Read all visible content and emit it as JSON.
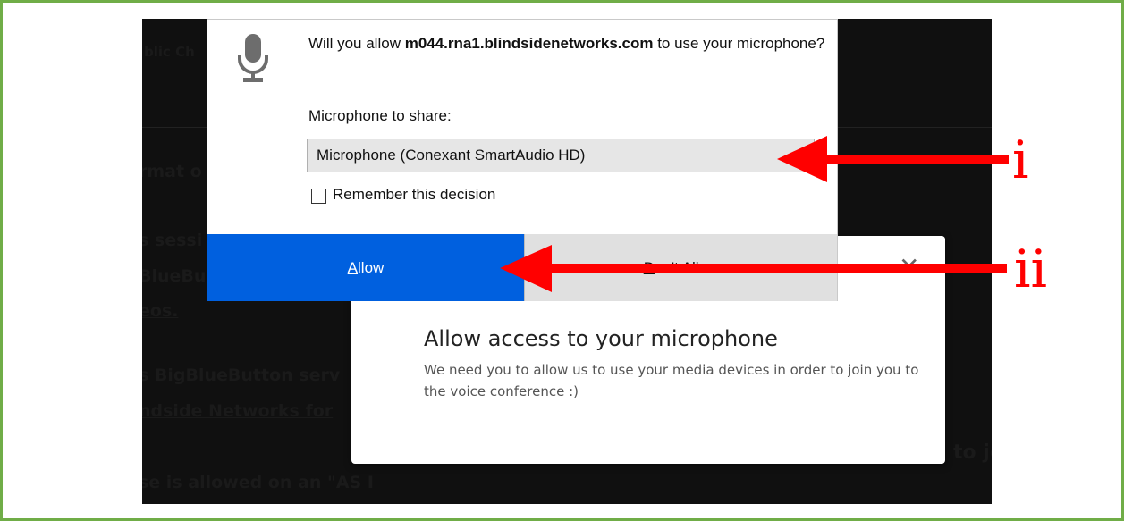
{
  "background": {
    "fragments": [
      {
        "text": "blic Ch",
        "underline": false
      },
      {
        "text": "rmat o",
        "underline": false
      },
      {
        "text": "s sessi",
        "underline": false
      },
      {
        "text": "BlueBu",
        "underline": false
      },
      {
        "text": "eos.",
        "underline": true
      },
      {
        "text": "s BigBlueButton serv",
        "underline": false
      },
      {
        "text": "ndside Networks for",
        "underline": false
      },
      {
        "text": "se is allowed on an \"AS I",
        "underline": false
      },
      {
        "text": "to jo",
        "underline": false
      }
    ]
  },
  "modal": {
    "close_icon": "close-icon",
    "close_glyph": "✕",
    "title": "Allow access to your microphone",
    "description": "We need you to allow us to use your media devices in order to join you to the voice conference :)"
  },
  "permission": {
    "icon": "microphone-icon",
    "question_prefix": "Will you allow ",
    "host": "m044.rna1.blindsidenetworks.com",
    "question_suffix": " to use your microphone?",
    "share_label_accesskey": "M",
    "share_label_rest": "icrophone to share:",
    "selected_device": "Microphone (Conexant SmartAudio HD)",
    "remember_label": "Remember this decision",
    "allow_label": "Allow",
    "deny_label": "Don't Allow"
  },
  "annotations": {
    "arrow_color": "#ff0000",
    "border_color": "#70ad47",
    "allow_color": "#0060df",
    "marker_i": "i",
    "marker_ii": "ii"
  }
}
